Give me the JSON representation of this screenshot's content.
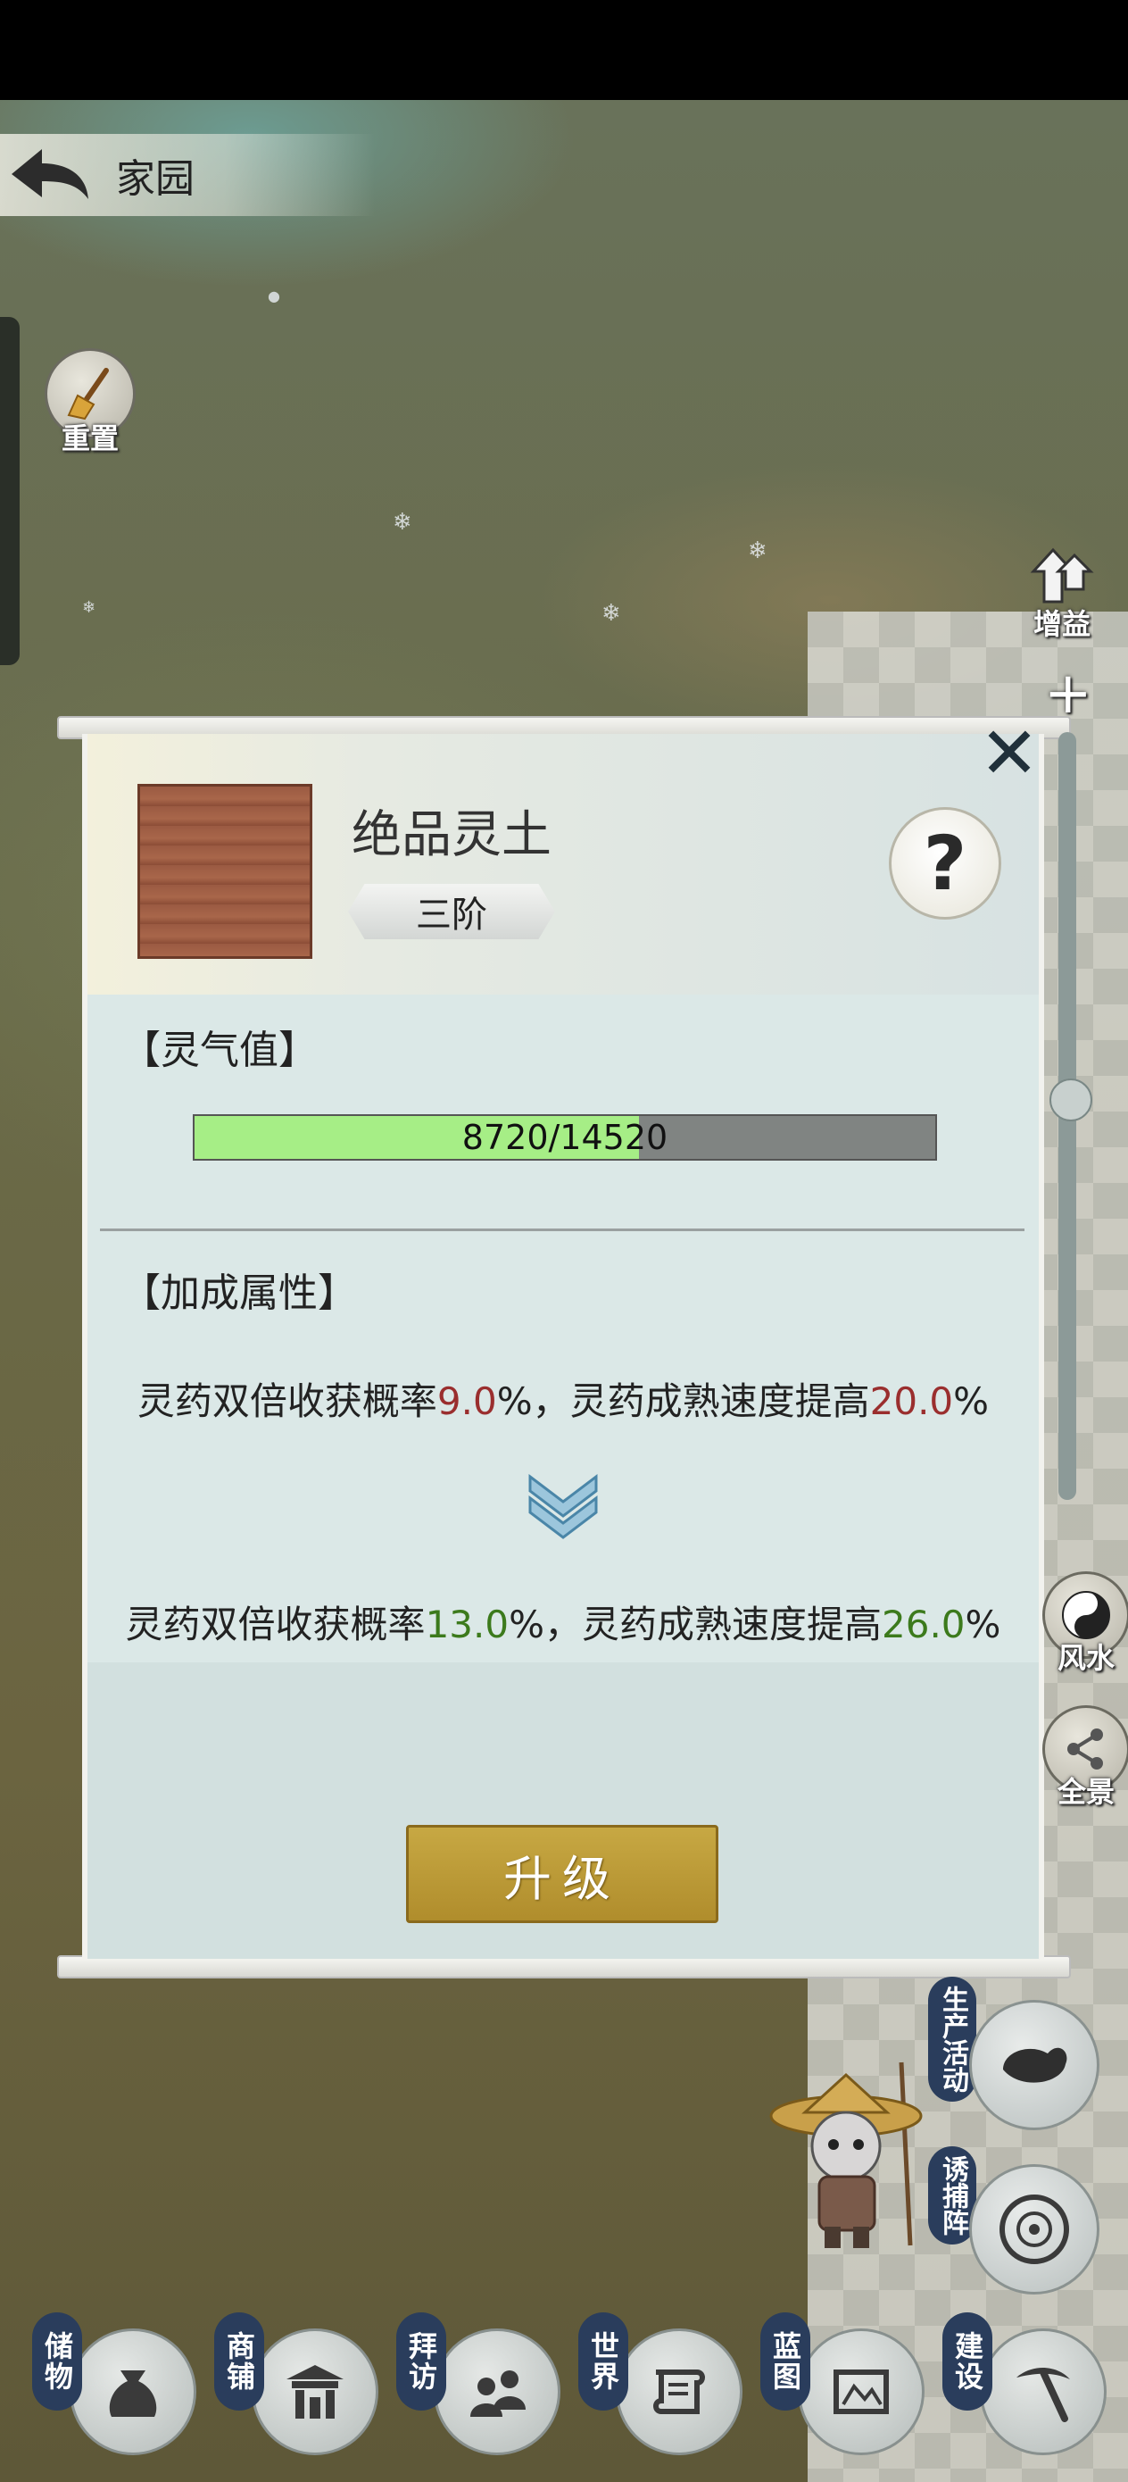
{
  "topbar": {
    "title": "家园"
  },
  "left_buttons": {
    "reset_label": "重置"
  },
  "right_buttons": {
    "buff_label": "增益",
    "fengshui_label": "风水",
    "panorama_label": "全景"
  },
  "side_tags": {
    "production": "生产活动",
    "trap": "诱捕阵"
  },
  "modal": {
    "item_name": "绝品灵土",
    "tier": "三阶",
    "help_symbol": "?",
    "close_symbol": "✕",
    "spirit_section_title": "【灵气值】",
    "spirit_progress": {
      "current": 8720,
      "max": 14520,
      "text": "8720/14520"
    },
    "bonus_section_title": "【加成属性】",
    "current_bonus": {
      "prefix": "灵药双倍收获概率",
      "value1": "9.0",
      "middle": "%，灵药成熟速度提高",
      "value2": "20.0",
      "suffix": "%"
    },
    "next_bonus": {
      "prefix": "灵药双倍收获概率",
      "value1": "13.0",
      "middle": "%，灵药成熟速度提高",
      "value2": "26.0",
      "suffix": "%"
    },
    "upgrade_label": "升级"
  },
  "bottom_nav": [
    {
      "label": "储物",
      "icon": "bag-icon"
    },
    {
      "label": "商铺",
      "icon": "shop-icon"
    },
    {
      "label": "拜访",
      "icon": "visit-icon"
    },
    {
      "label": "世界",
      "icon": "scroll-icon"
    },
    {
      "label": "蓝图",
      "icon": "blueprint-icon"
    },
    {
      "label": "建设",
      "icon": "pickaxe-icon"
    }
  ],
  "colors": {
    "bonus_current": "#9a2e2e",
    "bonus_next": "#3c7a1c",
    "progress_fill": "#a6ee86",
    "upgrade_button": "#b99a36"
  }
}
